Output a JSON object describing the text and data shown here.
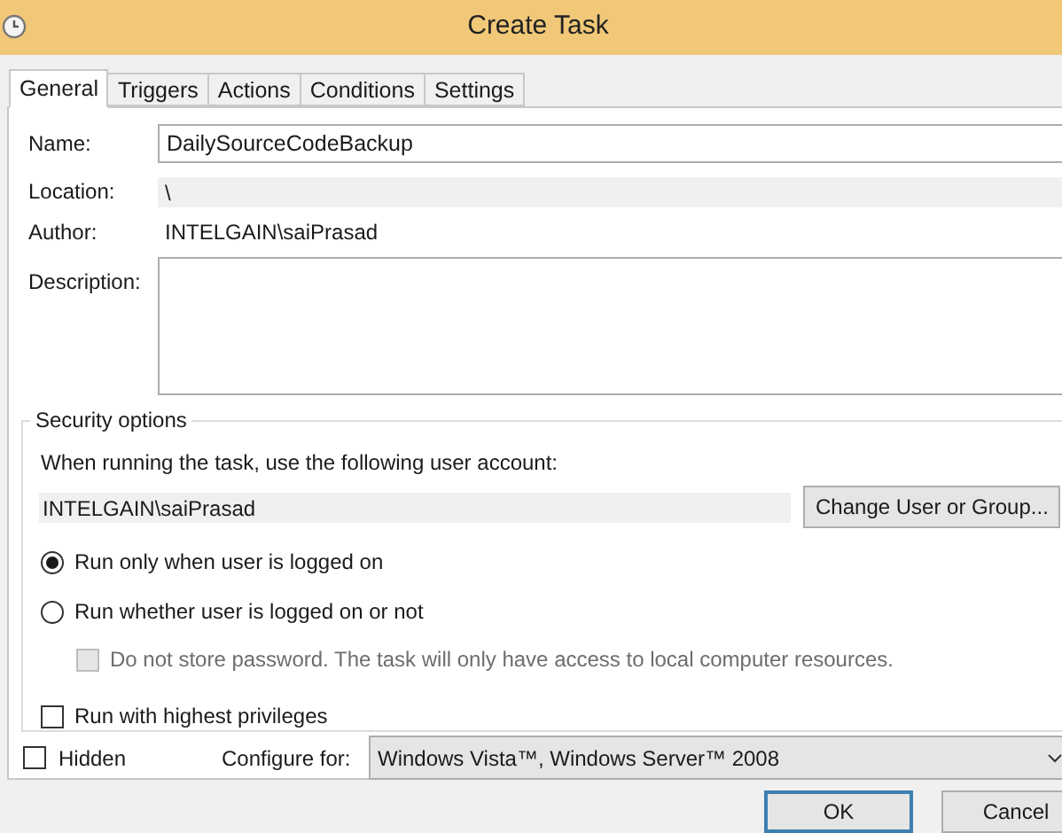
{
  "window": {
    "title": "Create Task"
  },
  "tabs": [
    {
      "label": "General",
      "selected": true
    },
    {
      "label": "Triggers",
      "selected": false
    },
    {
      "label": "Actions",
      "selected": false
    },
    {
      "label": "Conditions",
      "selected": false
    },
    {
      "label": "Settings",
      "selected": false
    }
  ],
  "name": {
    "label": "Name:",
    "value": "DailySourceCodeBackup"
  },
  "location": {
    "label": "Location:",
    "value": "\\"
  },
  "author": {
    "label": "Author:",
    "value": "INTELGAIN\\saiPrasad"
  },
  "description": {
    "label": "Description:"
  },
  "security": {
    "title": "Security options",
    "prompt": "When running the task, use the following user account:",
    "account": "INTELGAIN\\saiPrasad",
    "change_button": "Change User or Group...",
    "options": [
      {
        "kind": "radio",
        "label": "Run only when user is logged on",
        "selected": true,
        "disabled": false
      },
      {
        "kind": "radio",
        "label": "Run whether user is logged on or not",
        "selected": false,
        "disabled": false,
        "children": [
          {
            "kind": "checkbox",
            "label": "Do not store password.  The task will only have access to local computer resources.",
            "checked": false,
            "disabled": true
          }
        ]
      },
      {
        "kind": "checkbox",
        "label": "Run with highest privileges",
        "checked": false,
        "disabled": false
      }
    ]
  },
  "hidden": {
    "label": "Hidden",
    "checked": false
  },
  "configure": {
    "label": "Configure for:",
    "value": "Windows Vista™, Windows Server™ 2008"
  },
  "buttons": [
    {
      "label": "OK",
      "default": true
    },
    {
      "label": "Cancel",
      "default": false
    }
  ]
}
